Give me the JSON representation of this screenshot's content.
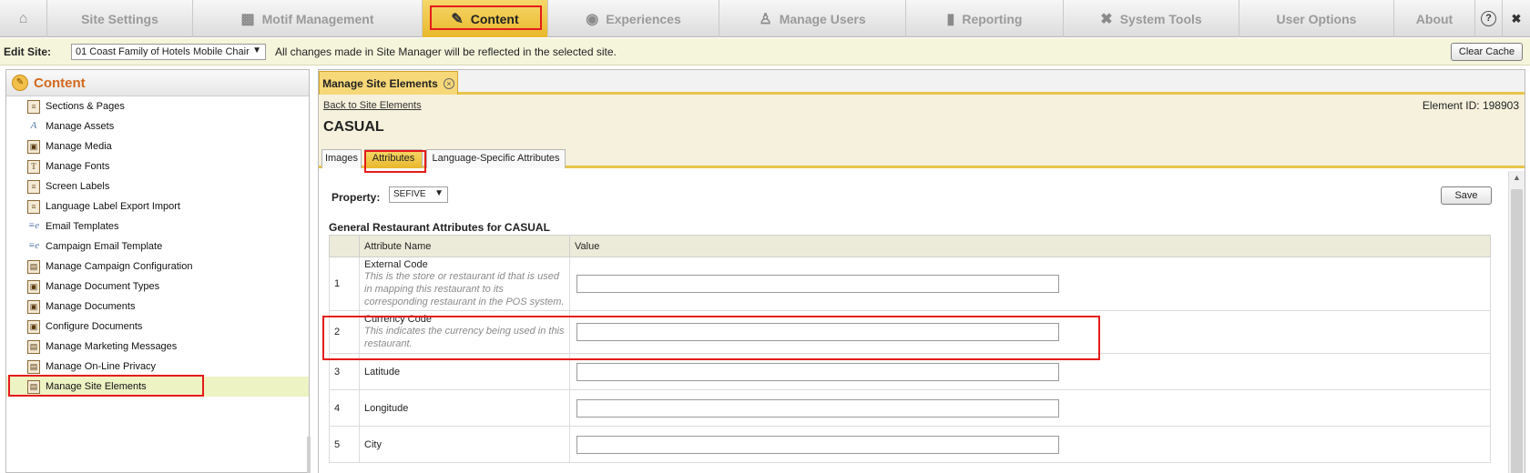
{
  "nav": {
    "home_icon": "home-icon",
    "items": [
      {
        "label": "Site Settings",
        "icon": ""
      },
      {
        "label": "Motif Management",
        "icon": "book-icon"
      },
      {
        "label": "Content",
        "icon": "edit-document-icon"
      },
      {
        "label": "Experiences",
        "icon": "globe-icon"
      },
      {
        "label": "Manage Users",
        "icon": "users-icon"
      },
      {
        "label": "Reporting",
        "icon": "bar-chart-icon"
      },
      {
        "label": "System Tools",
        "icon": "tools-icon"
      },
      {
        "label": "User Options",
        "icon": ""
      },
      {
        "label": "About",
        "icon": ""
      }
    ],
    "help": "?",
    "close": "✖"
  },
  "sitebar": {
    "label": "Edit Site:",
    "selected_site": "01 Coast Family of Hotels Mobile Chair",
    "message": "All changes made in Site Manager will be reflected in the selected site.",
    "clear_cache": "Clear Cache"
  },
  "sidebar": {
    "title": "Content",
    "items": [
      {
        "label": "Sections & Pages"
      },
      {
        "label": "Manage Assets"
      },
      {
        "label": "Manage Media"
      },
      {
        "label": "Manage Fonts"
      },
      {
        "label": "Screen Labels"
      },
      {
        "label": "Language Label Export Import"
      },
      {
        "label": "Email Templates"
      },
      {
        "label": "Campaign Email Template"
      },
      {
        "label": "Manage Campaign Configuration"
      },
      {
        "label": "Manage Document Types"
      },
      {
        "label": "Manage Documents"
      },
      {
        "label": "Configure Documents"
      },
      {
        "label": "Manage Marketing Messages"
      },
      {
        "label": "Manage On-Line Privacy"
      },
      {
        "label": "Manage Site Elements"
      }
    ]
  },
  "main": {
    "tab_label": "Manage Site Elements",
    "back_link": "Back to Site Elements",
    "element_id": "Element ID: 198903",
    "element_name": "CASUAL",
    "subtabs": [
      "Images",
      "Attributes",
      "Language-Specific Attributes"
    ],
    "property_label": "Property:",
    "property_value": "SEFIVE",
    "save_label": "Save",
    "section_title": "General Restaurant Attributes for CASUAL",
    "columns": [
      "Attribute Name",
      "Value"
    ],
    "rows": [
      {
        "num": "1",
        "name": "External Code",
        "desc": "This is the store or restaurant id that is used in mapping this restaurant to its corresponding restaurant in the POS system.",
        "value": ""
      },
      {
        "num": "2",
        "name": "Currency Code",
        "desc": "This indicates the currency being used in this restaurant.",
        "value": ""
      },
      {
        "num": "3",
        "name": "Latitude",
        "desc": "",
        "value": ""
      },
      {
        "num": "4",
        "name": "Longitude",
        "desc": "",
        "value": ""
      },
      {
        "num": "5",
        "name": "City",
        "desc": "",
        "value": ""
      }
    ]
  },
  "colors": {
    "accent_yellow": "#e9b82b",
    "panel_beige": "#f5f1dc",
    "title_orange": "#d2691e",
    "highlight_red": "#e51b1b"
  }
}
